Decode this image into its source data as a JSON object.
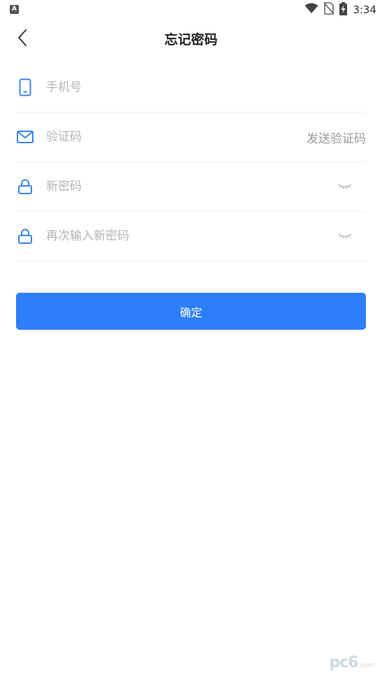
{
  "status_bar": {
    "left_icon": "A",
    "time": "3:34",
    "icons": [
      "wifi-icon",
      "no-sim-icon",
      "battery-charging-icon"
    ]
  },
  "header": {
    "title": "忘记密码",
    "back_icon": "chevron-left-icon"
  },
  "form": {
    "phone": {
      "placeholder": "手机号",
      "value": "",
      "icon": "phone-icon"
    },
    "code": {
      "placeholder": "验证码",
      "value": "",
      "icon": "mail-icon",
      "send_label": "发送验证码"
    },
    "new_password": {
      "placeholder": "新密码",
      "value": "",
      "icon": "lock-icon",
      "toggle_icon": "eye-closed-icon"
    },
    "confirm_password": {
      "placeholder": "再次输入新密码",
      "value": "",
      "icon": "lock-icon",
      "toggle_icon": "eye-closed-icon"
    }
  },
  "confirm_button": {
    "label": "确定"
  },
  "colors": {
    "accent": "#2d7ff9",
    "icon": "#3a86e8",
    "placeholder": "#b4b4b4",
    "divider": "#f0f0f0"
  },
  "watermark": {
    "text": "pc6",
    "suffix": ".com"
  }
}
